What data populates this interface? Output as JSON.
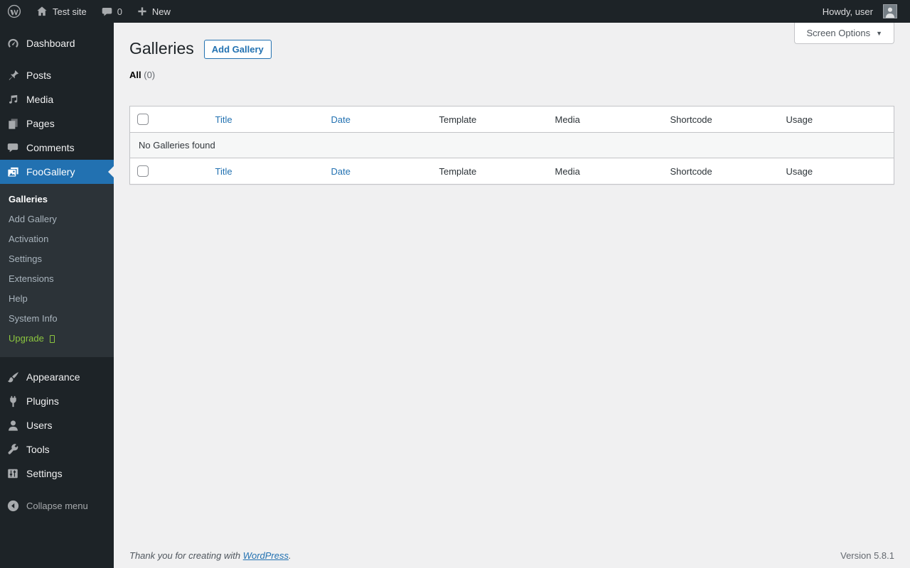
{
  "admin_bar": {
    "site_name": "Test site",
    "comment_count": "0",
    "new_label": "New",
    "howdy": "Howdy, user"
  },
  "sidebar": {
    "items": [
      {
        "label": "Dashboard"
      },
      {
        "label": "Posts"
      },
      {
        "label": "Media"
      },
      {
        "label": "Pages"
      },
      {
        "label": "Comments"
      },
      {
        "label": "FooGallery"
      },
      {
        "label": "Appearance"
      },
      {
        "label": "Plugins"
      },
      {
        "label": "Users"
      },
      {
        "label": "Tools"
      },
      {
        "label": "Settings"
      }
    ],
    "submenu": [
      "Galleries",
      "Add Gallery",
      "Activation",
      "Settings",
      "Extensions",
      "Help",
      "System Info",
      "Upgrade"
    ],
    "collapse_label": "Collapse menu"
  },
  "main": {
    "title": "Galleries",
    "add_gallery_label": "Add Gallery",
    "screen_options_label": "Screen Options",
    "filter_all": "All",
    "filter_count": "(0)",
    "table": {
      "columns": [
        "Title",
        "Date",
        "Template",
        "Media",
        "Shortcode",
        "Usage"
      ],
      "empty_message": "No Galleries found"
    }
  },
  "footer": {
    "thanks_prefix": "Thank you for creating with ",
    "wordpress_link": "WordPress",
    "period": ".",
    "version": "Version 5.8.1"
  },
  "colors": {
    "accent": "#2271b1",
    "menu-bg": "#1d2327",
    "submenu-bg": "#2c3338",
    "content-bg": "#f0f0f1",
    "green": "#8cc63f",
    "border": "#c3c4c7"
  }
}
